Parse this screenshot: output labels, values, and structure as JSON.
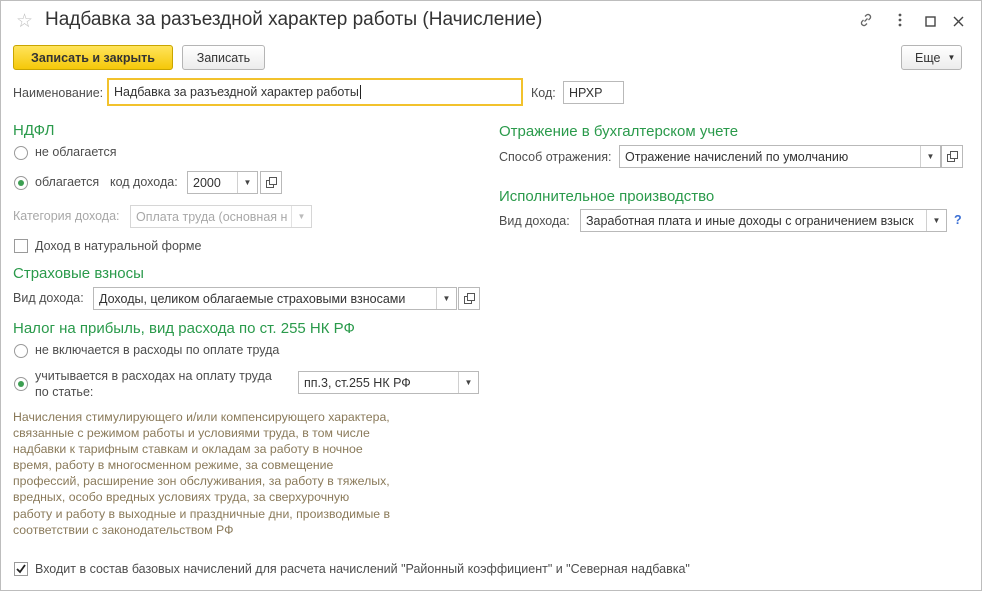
{
  "window": {
    "title": "Надбавка за разъездной характер работы (Начисление)"
  },
  "toolbar": {
    "save_close_label": "Записать и закрыть",
    "save_label": "Записать",
    "more_label": "Еще"
  },
  "fields": {
    "name_label": "Наименование:",
    "name_value": "Надбавка за разъездной характер работы",
    "code_label": "Код:",
    "code_value": "НРХР"
  },
  "ndfl": {
    "header": "НДФЛ",
    "not_taxed_label": "не облагается",
    "taxed_label": "облагается",
    "income_code_label": "код дохода:",
    "income_code_value": "2000",
    "category_label": "Категория дохода:",
    "category_value": "Оплата труда (основная н",
    "natural_form_label": "Доход в натуральной форме"
  },
  "insurance": {
    "header": "Страховые взносы",
    "income_type_label": "Вид дохода:",
    "income_type_value": "Доходы, целиком облагаемые страховыми взносами"
  },
  "profit_tax": {
    "header": "Налог на прибыль, вид расхода по ст. 255 НК РФ",
    "not_included_label": "не включается в расходы по оплате труда",
    "included_label_line1": "учитывается в расходах на оплату труда",
    "included_label_line2": "по статье:",
    "article_value": "пп.3, ст.255 НК РФ",
    "note": "Начисления стимулирующего и/или компенсирующего характера,\nсвязанные с режимом работы и условиями труда, в том числе\nнадбавки к тарифным ставкам и окладам за работу в ночное\nвремя, работу в многосменном режиме, за совмещение\nпрофессий, расширение зон обслуживания, за работу в тяжелых,\nвредных, особо вредных условиях труда, за сверхурочную\nработу и работу в выходные и праздничные дни, производимые в\nсоответствии с законодательством РФ"
  },
  "accounting": {
    "header": "Отражение в бухгалтерском учете",
    "method_label": "Способ отражения:",
    "method_value": "Отражение начислений по умолчанию"
  },
  "enforcement": {
    "header": "Исполнительное производство",
    "income_type_label": "Вид дохода:",
    "income_type_value": "Заработная плата и иные доходы с ограничением взыск",
    "help": "?"
  },
  "footer": {
    "base_accruals_label": "Входит в состав базовых начислений для расчета начислений \"Районный коэффициент\" и \"Северная надбавка\""
  },
  "icons": {
    "star": "star-icon",
    "link": "link-icon",
    "menu": "more-vertical-icon",
    "maximize": "maximize-icon",
    "close": "close-icon",
    "dropdown": "chevron-down-icon",
    "open": "open-form-icon"
  },
  "colors": {
    "accent_section": "#2a9a4b",
    "primary_button": "#f5c809",
    "focus_border": "#f2c22c",
    "note_text": "#8a7a5a",
    "help": "#3b6fd4"
  }
}
